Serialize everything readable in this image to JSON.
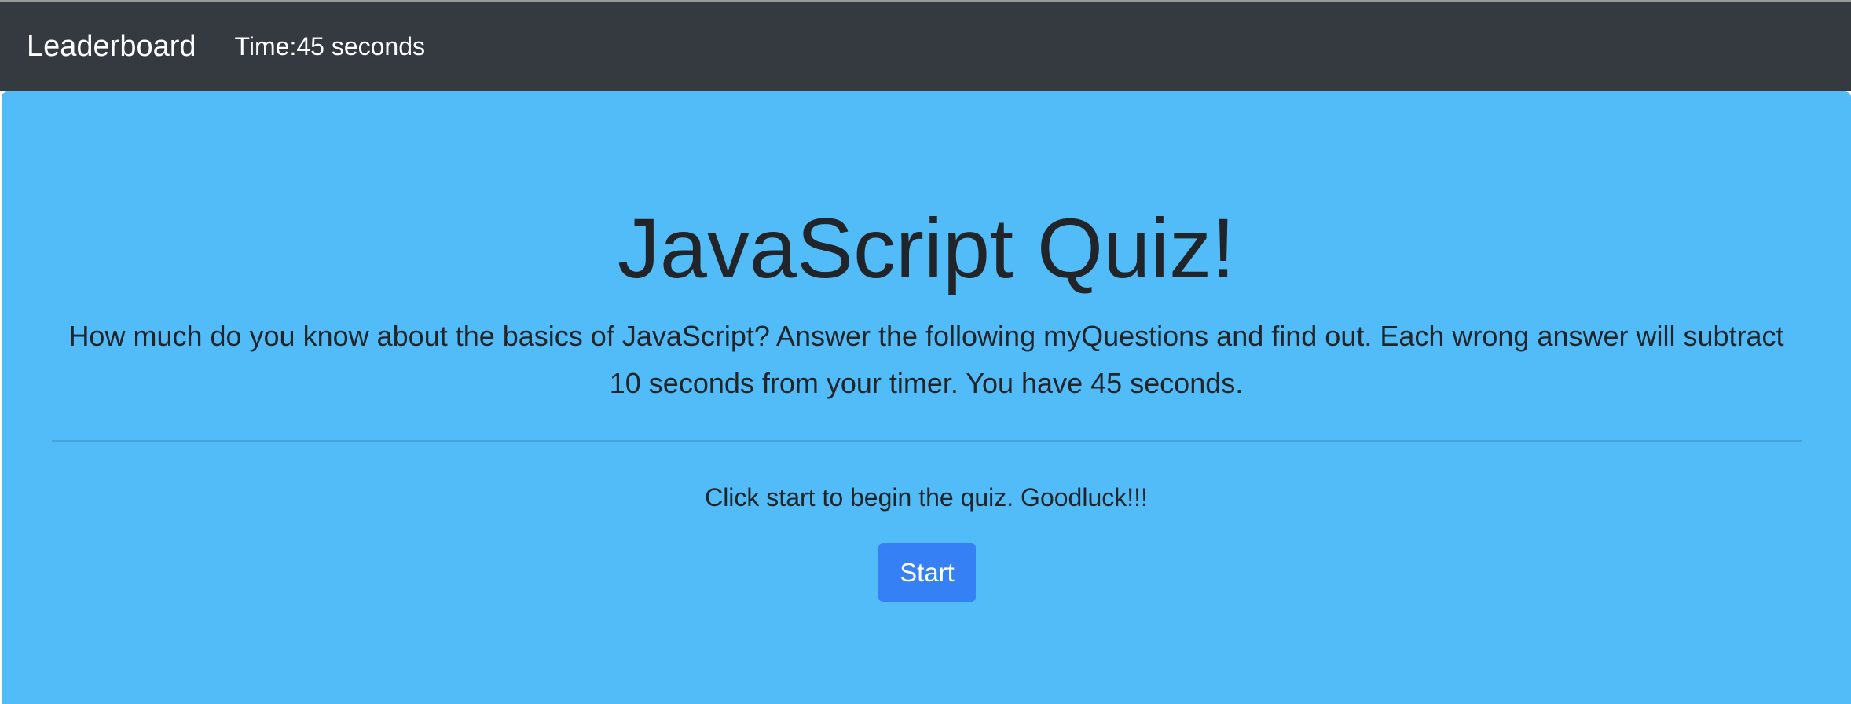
{
  "navbar": {
    "brand_label": "Leaderboard",
    "timer_text": "Time:45 seconds"
  },
  "jumbotron": {
    "title": "JavaScript Quiz!",
    "lead": "How much do you know about the basics of JavaScript? Answer the following myQuestions and find out. Each wrong answer will subtract 10 seconds from your timer. You have 45 seconds.",
    "instructions": "Click start to begin the quiz. Goodluck!!!",
    "start_button_label": "Start"
  },
  "colors": {
    "navbar_bg": "#343a40",
    "jumbotron_bg": "#52bcf9",
    "button_bg": "#3680f5",
    "text": "#212529"
  }
}
